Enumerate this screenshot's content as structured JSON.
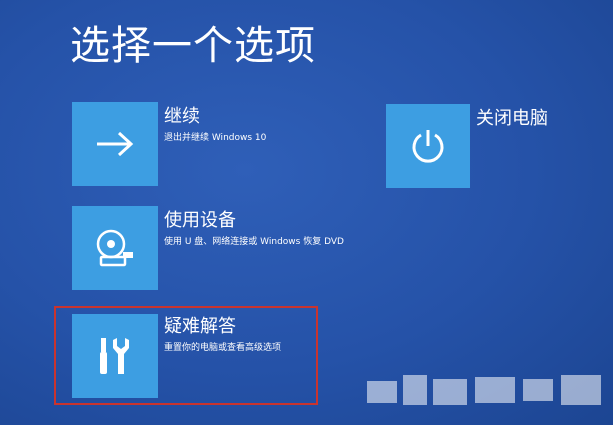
{
  "page": {
    "title": "选择一个选项"
  },
  "options": {
    "continue": {
      "title": "继续",
      "description": "退出并继续 Windows 10",
      "icon": "arrow-right-icon"
    },
    "use_device": {
      "title": "使用设备",
      "description": "使用 U 盘、网络连接或 Windows 恢复 DVD",
      "icon": "disc-drive-icon"
    },
    "troubleshoot": {
      "title": "疑难解答",
      "description": "重置你的电脑或查看高级选项",
      "icon": "tools-icon",
      "highlight_color": "#c9342e"
    },
    "shutdown": {
      "title": "关闭电脑",
      "icon": "power-icon"
    }
  },
  "colors": {
    "background": "#2552a8",
    "tile": "#3d9ee2",
    "text": "#ffffff"
  }
}
